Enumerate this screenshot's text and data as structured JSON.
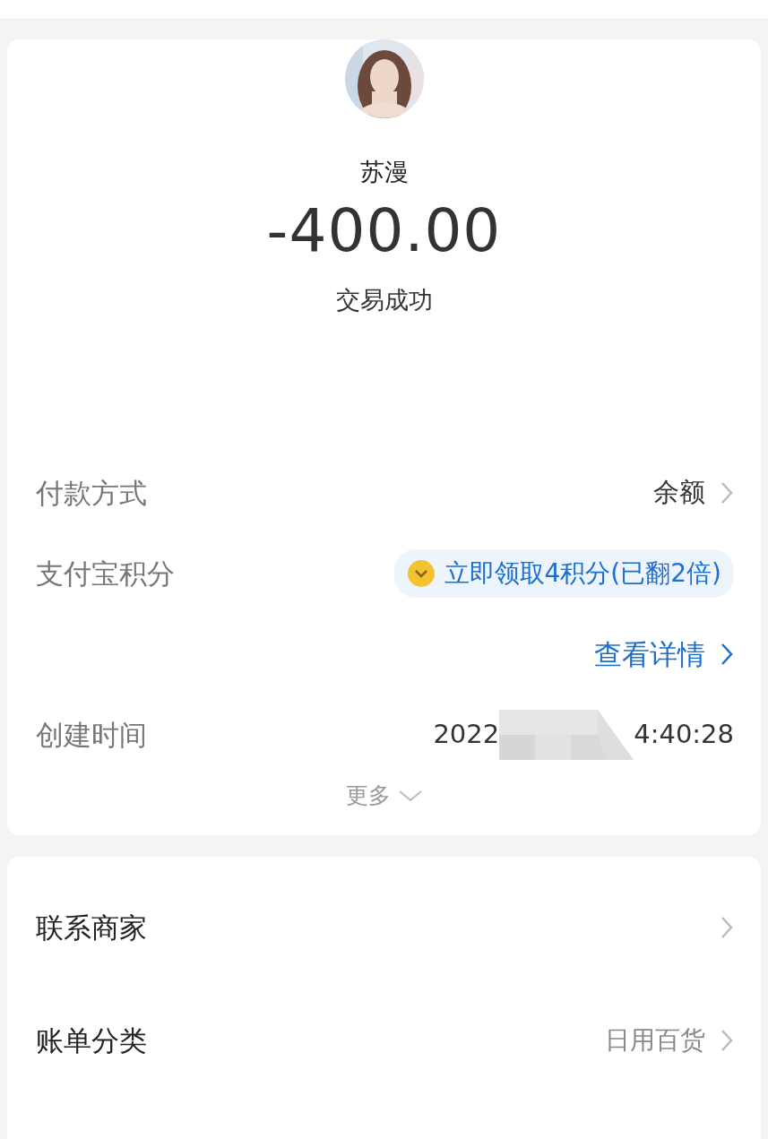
{
  "payee": {
    "name": "苏漫",
    "amount": "-400.00",
    "status": "交易成功"
  },
  "details": [
    {
      "kind": "link",
      "label": "付款方式",
      "value": "余额"
    },
    {
      "kind": "points",
      "label": "支付宝积分",
      "value": "立即领取4积分(已翻2倍)"
    },
    {
      "kind": "more_link",
      "value": "查看详情"
    },
    {
      "kind": "time",
      "label": "创建时间",
      "value_start": "2022",
      "value_end": "4:40:28",
      "redacted": true
    }
  ],
  "more": "更多",
  "actions": [
    {
      "label": "联系商家"
    },
    {
      "label": "账单分类",
      "value": "日用百货"
    }
  ]
}
